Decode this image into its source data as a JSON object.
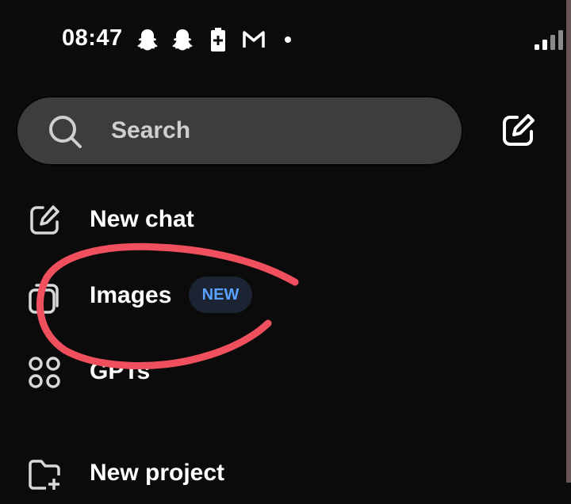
{
  "status_bar": {
    "time": "08:47",
    "icons": [
      "snapchat-icon",
      "snapchat-icon",
      "battery-saver-icon",
      "gmail-icon",
      "notification-dot-icon",
      "signal-icon"
    ]
  },
  "search": {
    "placeholder": "Search",
    "compose_icon": "compose-icon"
  },
  "menu": {
    "items": [
      {
        "label": "New chat",
        "icon": "edit-icon"
      },
      {
        "label": "Images",
        "icon": "images-icon",
        "badge": "NEW"
      },
      {
        "label": "GPTs",
        "icon": "grid-icon"
      },
      {
        "label": "New project",
        "icon": "folder-add-icon"
      }
    ]
  },
  "colors": {
    "background": "#0b0b0b",
    "search_bg": "#3d3d3d",
    "badge_bg": "#1c2433",
    "badge_text": "#5aa2ff",
    "annotation": "#f0505e"
  }
}
